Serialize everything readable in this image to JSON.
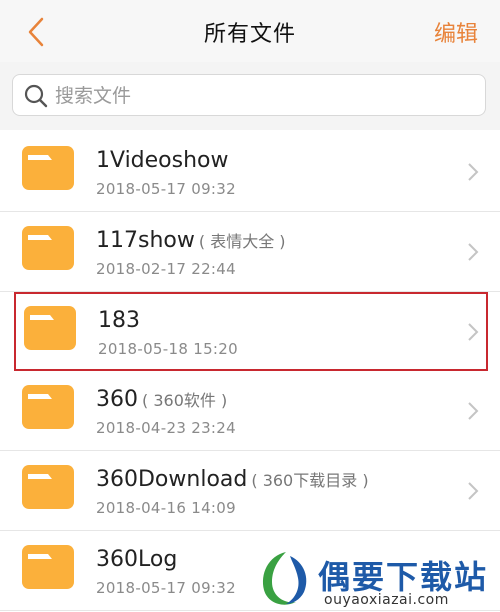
{
  "header": {
    "title": "所有文件",
    "edit_label": "编辑"
  },
  "search": {
    "placeholder": "搜索文件"
  },
  "files": [
    {
      "name": "1Videoshow",
      "alias": "",
      "date": "2018-05-17 09:32"
    },
    {
      "name": "117show",
      "alias": "( 表情大全 )",
      "date": "2018-02-17 22:44"
    },
    {
      "name": "183",
      "alias": "",
      "date": "2018-05-18 15:20"
    },
    {
      "name": "360",
      "alias": "( 360软件 )",
      "date": "2018-04-23 23:24"
    },
    {
      "name": "360Download",
      "alias": "( 360下载目录 )",
      "date": "2018-04-16 14:09"
    },
    {
      "name": "360Log",
      "alias": "",
      "date": "2018-05-17 09:32"
    }
  ],
  "watermark": {
    "brand": "偶要下载站",
    "url": "ouyaoxiazai.com"
  },
  "colors": {
    "accent": "#e8833a",
    "folder": "#fbb03b",
    "highlight": "#c8282f"
  }
}
